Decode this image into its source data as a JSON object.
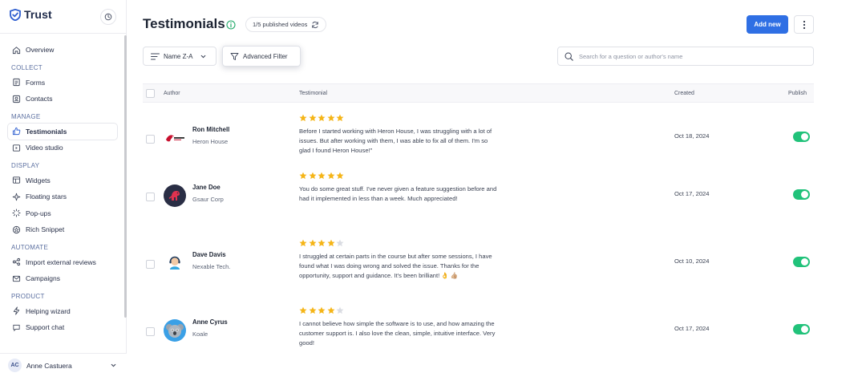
{
  "brand": {
    "name": "Trust"
  },
  "sidebar": {
    "overview": "Overview",
    "sections": [
      {
        "title": "COLLECT",
        "items": [
          {
            "label": "Forms",
            "icon": "forms-icon"
          },
          {
            "label": "Contacts",
            "icon": "contacts-icon"
          }
        ]
      },
      {
        "title": "MANAGE",
        "items": [
          {
            "label": "Testimonials",
            "icon": "thumbs-up-icon",
            "active": true
          },
          {
            "label": "Video studio",
            "icon": "video-icon"
          }
        ]
      },
      {
        "title": "DISPLAY",
        "items": [
          {
            "label": "Widgets",
            "icon": "widgets-icon"
          },
          {
            "label": "Floating stars",
            "icon": "sparkle-icon"
          },
          {
            "label": "Pop-ups",
            "icon": "loader-icon"
          },
          {
            "label": "Rich Snippet",
            "icon": "snippet-icon"
          }
        ]
      },
      {
        "title": "AUTOMATE",
        "items": [
          {
            "label": "Import external reviews",
            "icon": "share-icon"
          },
          {
            "label": "Campaigns",
            "icon": "mail-icon"
          }
        ]
      },
      {
        "title": "PRODUCT",
        "items": [
          {
            "label": "Helping wizard",
            "icon": "bolt-icon"
          },
          {
            "label": "Support chat",
            "icon": "chat-icon"
          }
        ]
      }
    ],
    "user": {
      "initials": "AC",
      "name": "Anne Castuera"
    }
  },
  "header": {
    "title": "Testimonials",
    "published_badge": "1/5 published videos",
    "add_button": "Add new"
  },
  "toolbar": {
    "sort_label": "Name Z-A",
    "filter_label": "Advanced Filter",
    "search_placeholder": "Search for a question or author's name"
  },
  "table": {
    "columns": {
      "author": "Author",
      "testimonial": "Testimonial",
      "created": "Created",
      "publish": "Publish"
    },
    "rows": [
      {
        "name": "Ron Mitchell",
        "company": "Heron House",
        "rating": 5,
        "text": "Before I started working with Heron House, I was struggling with a lot of issues. But after working with them, I was able to fix all of them. I'm so glad I found Heron House!\"",
        "created": "Oct 18, 2024",
        "published": true,
        "avatar": "heron-logo"
      },
      {
        "name": "Jane Doe",
        "company": "Gsaur Corp",
        "rating": 5,
        "text": "You do some great stuff. I've never given a feature suggestion before and had it implemented in less than a week. Much appreciated!",
        "created": "Oct 17, 2024",
        "published": true,
        "avatar": "dino-logo"
      },
      {
        "name": "Dave Davis",
        "company": "Nexable Tech.",
        "rating": 4,
        "text": "I struggled at certain parts in the course but after some sessions, I have found what I was doing wrong and solved the issue. Thanks for the opportunity, support and guidance. It's been brilliant! 👌 👍🏼",
        "created": "Oct 10, 2024",
        "published": true,
        "avatar": "support-avatar"
      },
      {
        "name": "Anne Cyrus",
        "company": "Koale",
        "rating": 4,
        "text": "I cannot believe how simple the software is to use, and how amazing the customer support is. I also love the clean, simple, intuitive interface. Very good!",
        "created": "Oct 17, 2024",
        "published": true,
        "avatar": "koala-avatar"
      }
    ]
  },
  "colors": {
    "accent": "#2f6fe4",
    "toggle_on": "#21c27a",
    "star": "#f5b518",
    "star_off": "#dadce2"
  }
}
